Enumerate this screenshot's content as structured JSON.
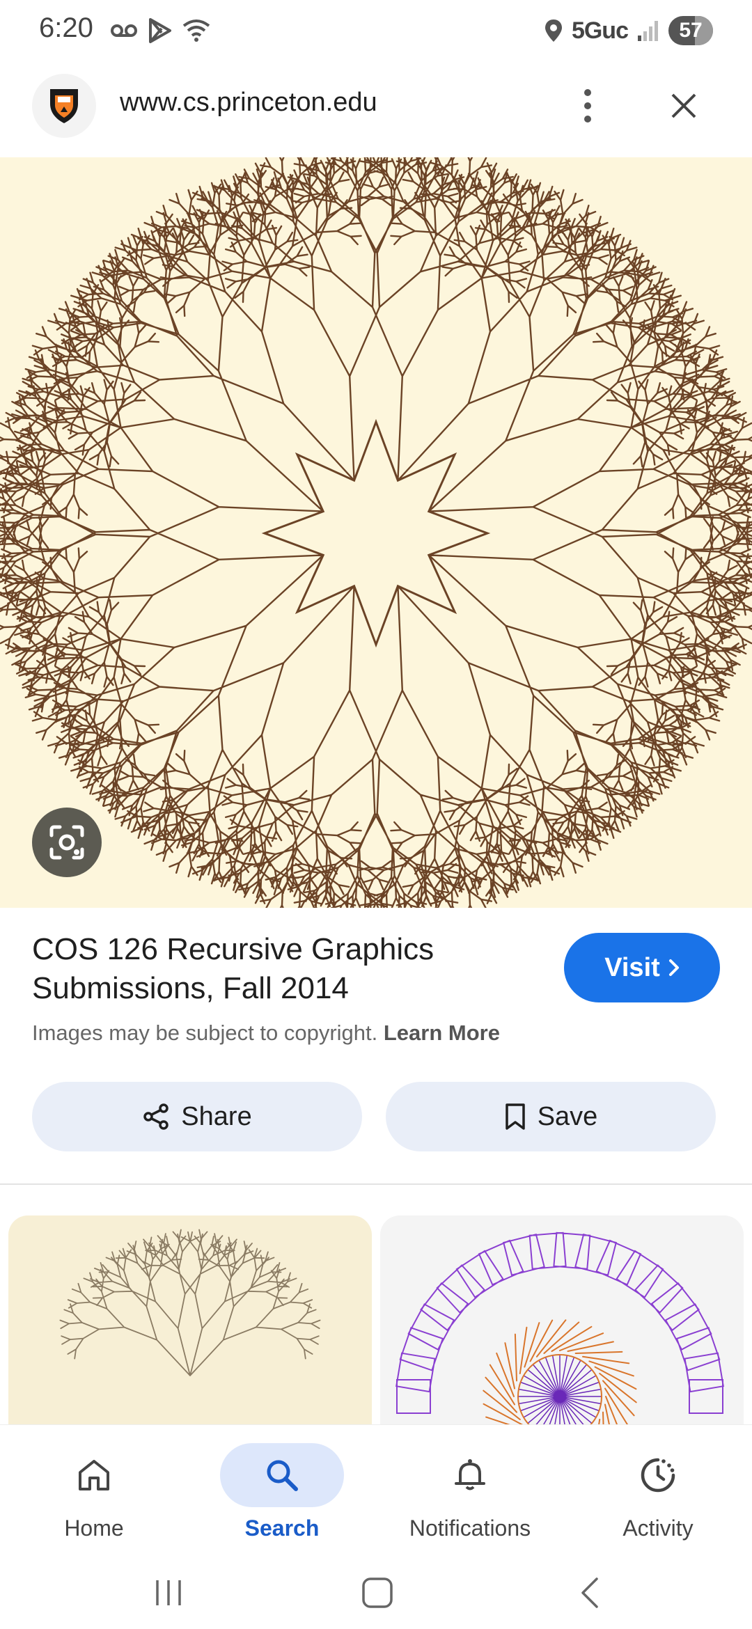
{
  "status_bar": {
    "time": "6:20",
    "network": "5Guc",
    "battery": "57"
  },
  "url_bar": {
    "url": "www.cs.princeton.edu",
    "site_icon": "princeton-shield-icon"
  },
  "result": {
    "title": "COS 126 Recursive Graphics Submissions, Fall 2014",
    "visit_label": "Visit",
    "copyright_text": "Images may be subject to copyright.",
    "learn_more": "Learn More",
    "share_label": "Share",
    "save_label": "Save"
  },
  "bottom_nav": {
    "items": [
      {
        "label": "Home",
        "icon": "home-icon"
      },
      {
        "label": "Search",
        "icon": "search-icon"
      },
      {
        "label": "Notifications",
        "icon": "bell-icon"
      },
      {
        "label": "Activity",
        "icon": "activity-icon"
      }
    ],
    "active": "Search"
  },
  "colors": {
    "accent": "#1a73e8",
    "hero_bg": "#fdf6dc",
    "fractal": "#6b4326"
  }
}
